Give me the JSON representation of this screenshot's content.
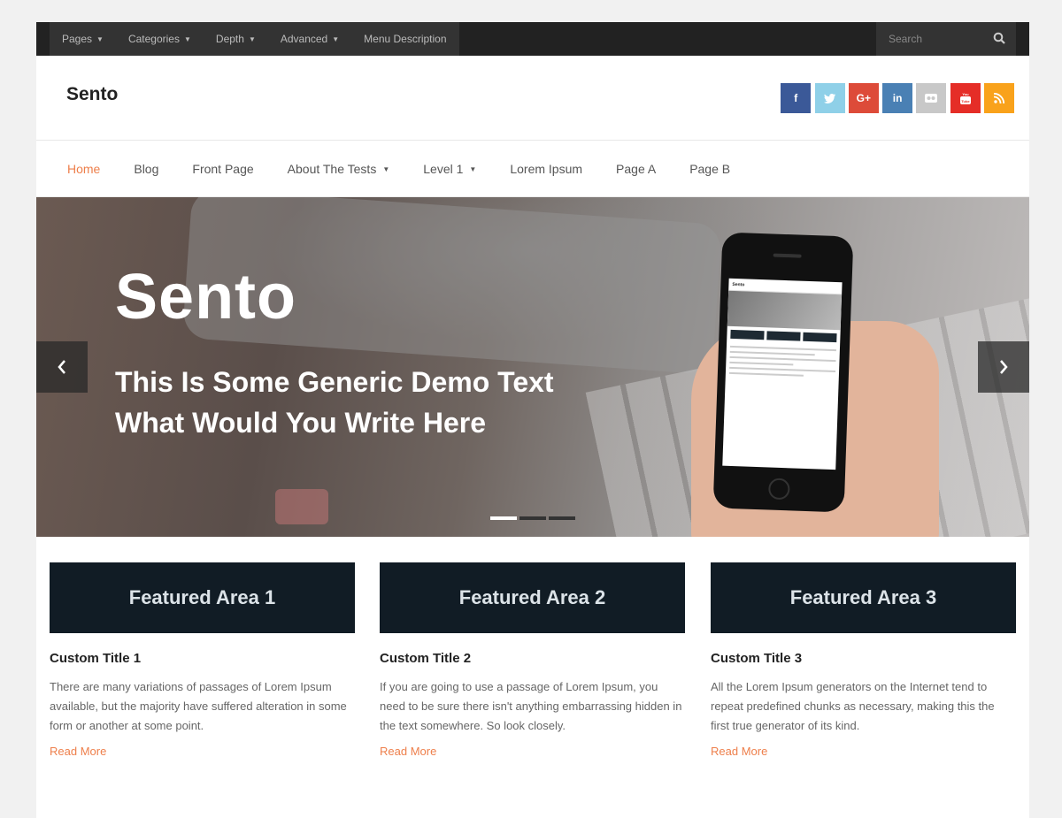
{
  "topbar": {
    "menu": [
      {
        "label": "Pages",
        "has_dropdown": true
      },
      {
        "label": "Categories",
        "has_dropdown": true
      },
      {
        "label": "Depth",
        "has_dropdown": true
      },
      {
        "label": "Advanced",
        "has_dropdown": true
      },
      {
        "label": "Menu Description",
        "has_dropdown": false
      }
    ],
    "search": {
      "placeholder": "Search",
      "icon": "search-icon"
    }
  },
  "header": {
    "site_title": "Sento",
    "social": [
      {
        "name": "facebook",
        "glyph": "f",
        "color": "#3b5998"
      },
      {
        "name": "twitter",
        "glyph": "t",
        "color": "#8fd0e8"
      },
      {
        "name": "google-plus",
        "glyph": "G+",
        "color": "#dd4b39"
      },
      {
        "name": "linkedin",
        "glyph": "in",
        "color": "#4a80b4"
      },
      {
        "name": "flickr",
        "glyph": "••",
        "color": "#c8c8c8"
      },
      {
        "name": "youtube",
        "glyph": "▶",
        "color": "#e52d27"
      },
      {
        "name": "rss",
        "glyph": ")",
        "color": "#f9a21b"
      }
    ]
  },
  "mainnav": {
    "items": [
      {
        "label": "Home",
        "active": true,
        "has_dropdown": false
      },
      {
        "label": "Blog",
        "active": false,
        "has_dropdown": false
      },
      {
        "label": "Front Page",
        "active": false,
        "has_dropdown": false
      },
      {
        "label": "About The Tests",
        "active": false,
        "has_dropdown": true
      },
      {
        "label": "Level 1",
        "active": false,
        "has_dropdown": true
      },
      {
        "label": "Lorem Ipsum",
        "active": false,
        "has_dropdown": false
      },
      {
        "label": "Page A",
        "active": false,
        "has_dropdown": false
      },
      {
        "label": "Page B",
        "active": false,
        "has_dropdown": false
      }
    ]
  },
  "slider": {
    "title": "Sento",
    "text_line1": "This Is Some Generic Demo Text",
    "text_line2": "What Would You Write Here",
    "active_slide": 1,
    "slide_count": 3,
    "phone_screen_title": "Sento"
  },
  "featured": [
    {
      "box_label": "Featured Area 1",
      "title": "Custom Title 1",
      "text": "There are many variations of passages of Lorem Ipsum available, but the majority have suffered alteration in some form or another at some point.",
      "link": "Read More"
    },
    {
      "box_label": "Featured Area 2",
      "title": "Custom Title 2",
      "text": "If you are going to use a passage of Lorem Ipsum, you need to be sure there isn't anything embarrassing hidden in the text somewhere. So look closely.",
      "link": "Read More"
    },
    {
      "box_label": "Featured Area 3",
      "title": "Custom Title 3",
      "text": "All the Lorem Ipsum generators on the Internet tend to repeat predefined chunks as necessary, making this the first true generator of its kind.",
      "link": "Read More"
    }
  ],
  "colors": {
    "accent": "#ee7f4b",
    "topbar": "#222222",
    "featured_box": "#111c25"
  }
}
